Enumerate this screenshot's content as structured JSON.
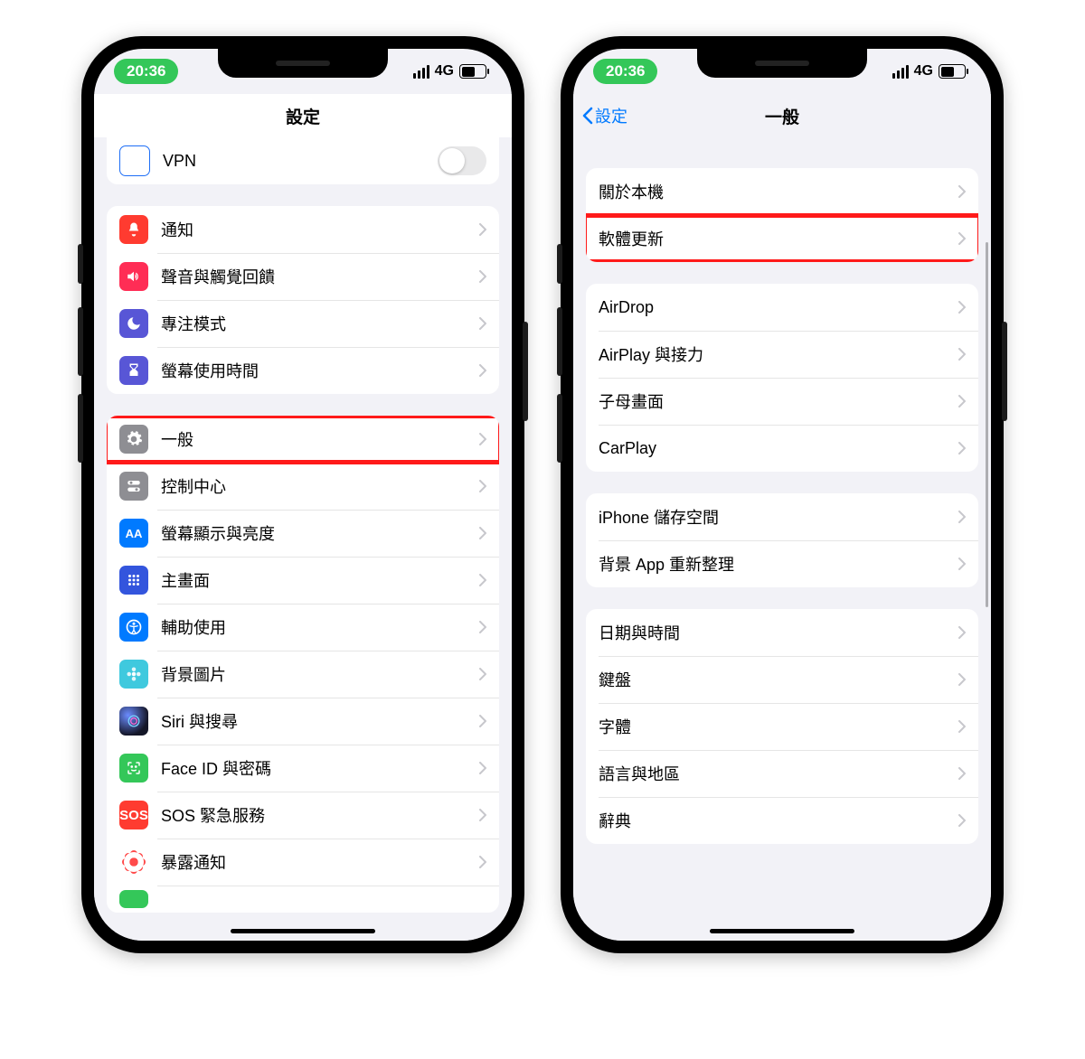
{
  "status": {
    "time": "20:36",
    "network": "4G"
  },
  "left": {
    "title": "設定",
    "vpn_label": "VPN",
    "group_notify": [
      {
        "key": "notify",
        "label": "通知"
      },
      {
        "key": "sound",
        "label": "聲音與觸覺回饋"
      },
      {
        "key": "focus",
        "label": "專注模式"
      },
      {
        "key": "screentime",
        "label": "螢幕使用時間"
      }
    ],
    "group_general": [
      {
        "key": "general",
        "label": "一般"
      },
      {
        "key": "control",
        "label": "控制中心"
      },
      {
        "key": "display",
        "label": "螢幕顯示與亮度"
      },
      {
        "key": "home",
        "label": "主畫面"
      },
      {
        "key": "access",
        "label": "輔助使用"
      },
      {
        "key": "wallpaper",
        "label": "背景圖片"
      },
      {
        "key": "siri",
        "label": "Siri 與搜尋"
      },
      {
        "key": "faceid",
        "label": "Face ID 與密碼"
      },
      {
        "key": "sos",
        "label": "SOS 緊急服務"
      },
      {
        "key": "exposure",
        "label": "暴露通知"
      }
    ]
  },
  "right": {
    "back": "設定",
    "title": "一般",
    "g1": [
      {
        "key": "about",
        "label": "關於本機"
      },
      {
        "key": "update",
        "label": "軟體更新"
      }
    ],
    "g2": [
      {
        "key": "airdrop",
        "label": "AirDrop"
      },
      {
        "key": "airplay",
        "label": "AirPlay 與接力"
      },
      {
        "key": "pip",
        "label": "子母畫面"
      },
      {
        "key": "carplay",
        "label": "CarPlay"
      }
    ],
    "g3": [
      {
        "key": "storage",
        "label": "iPhone 儲存空間"
      },
      {
        "key": "bgapp",
        "label": "背景 App 重新整理"
      }
    ],
    "g4": [
      {
        "key": "datetime",
        "label": "日期與時間"
      },
      {
        "key": "keyboard",
        "label": "鍵盤"
      },
      {
        "key": "font",
        "label": "字體"
      },
      {
        "key": "lang",
        "label": "語言與地區"
      },
      {
        "key": "dict",
        "label": "辭典"
      }
    ]
  }
}
